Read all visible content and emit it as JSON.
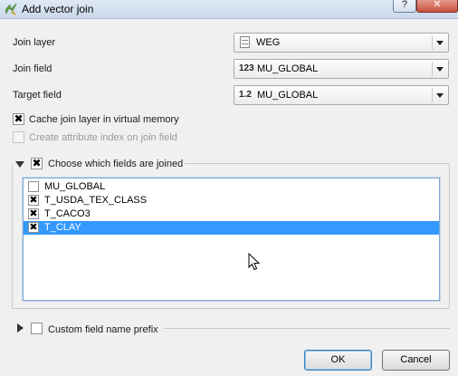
{
  "window": {
    "title": "Add vector join",
    "help_label": "?",
    "close_label": "✕"
  },
  "form": {
    "join_layer": {
      "label": "Join layer",
      "value": "WEG"
    },
    "join_field": {
      "label": "Join field",
      "type_prefix": "123",
      "value": "MU_GLOBAL"
    },
    "target_field": {
      "label": "Target field",
      "type_prefix": "1.2",
      "value": "MU_GLOBAL"
    }
  },
  "options": {
    "cache": {
      "label": "Cache join layer in virtual memory",
      "checked": true,
      "enabled": true
    },
    "index": {
      "label": "Create attribute index on join field",
      "checked": false,
      "enabled": false
    }
  },
  "fields_group": {
    "label": "Choose which fields are joined",
    "checked": true,
    "expanded": true,
    "fields": [
      {
        "label": "MU_GLOBAL",
        "checked": false,
        "selected": false
      },
      {
        "label": "T_USDA_TEX_CLASS",
        "checked": true,
        "selected": false
      },
      {
        "label": "T_CACO3",
        "checked": true,
        "selected": false
      },
      {
        "label": "T_CLAY",
        "checked": true,
        "selected": true
      }
    ]
  },
  "prefix_group": {
    "label": "Custom field name prefix",
    "checked": false,
    "expanded": false
  },
  "buttons": {
    "ok": "OK",
    "cancel": "Cancel"
  },
  "check_glyph": "✖",
  "colors": {
    "selection": "#3399ff",
    "titlebar": "#dfe9f5",
    "close_button": "#c9513d"
  }
}
